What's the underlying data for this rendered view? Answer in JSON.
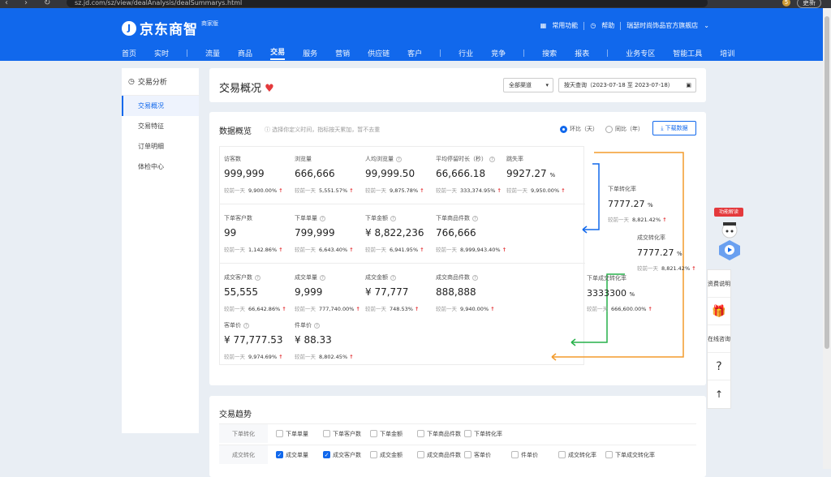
{
  "browser": {
    "url": "sz.jd.com/sz/view/dealAnalysis/dealSummarys.html",
    "profile": "5",
    "update_label": "更新"
  },
  "header": {
    "logo_text": "京东商智",
    "logo_badge": "商家版",
    "links": [
      "常用功能",
      "帮助",
      "瑞瑟时尚饰品官方旗舰店"
    ],
    "nav": [
      "首页",
      "实时",
      "流量",
      "商品",
      "交易",
      "服务",
      "营销",
      "供应链",
      "客户",
      "行业",
      "竞争",
      "搜索",
      "报表",
      "业务专区",
      "智能工具",
      "培训"
    ],
    "active_nav": "交易"
  },
  "sidebar": {
    "title": "交易分析",
    "items": [
      "交易概况",
      "交易特征",
      "订单明细",
      "体检中心"
    ],
    "active": "交易概况"
  },
  "topbar": {
    "title": "交易概况",
    "channel": "全部渠道",
    "date_range": "按天查询（2023-07-18 至 2023-07-18）"
  },
  "overview": {
    "title": "数据概览",
    "hint": "选择你定义时间，指标按天累加，暂不去重",
    "radio": [
      "环比（天）",
      "同比（年）"
    ],
    "download": "下载数据",
    "compare_label": "较前一天",
    "cards": [
      {
        "label": "访客数",
        "value": "999,999",
        "unit": "",
        "change": "9,900.00%"
      },
      {
        "label": "浏览量",
        "value": "666,666",
        "unit": "",
        "change": "5,551.57%"
      },
      {
        "label": "人均浏览量",
        "value": "99,999.50",
        "unit": "",
        "change": "9,875.78%"
      },
      {
        "label": "平均停留时长（秒）",
        "value": "66,666.18",
        "unit": "",
        "change": "333,374.95%"
      },
      {
        "label": "跳失率",
        "value": "9927.27",
        "unit": "%",
        "change": "9,950.00%"
      },
      {
        "label": "下单客户数",
        "value": "99",
        "unit": "",
        "change": "1,142.86%"
      },
      {
        "label": "下单单量",
        "value": "799,999",
        "unit": "",
        "change": "6,643.40%"
      },
      {
        "label": "下单金额",
        "value": "¥ 8,822,236",
        "unit": "",
        "change": "6,941.95%"
      },
      {
        "label": "下单商品件数",
        "value": "766,666",
        "unit": "",
        "change": "8,999,943.40%"
      },
      {
        "label": "成交客户数",
        "value": "55,555",
        "unit": "",
        "change": "66,642.86%"
      },
      {
        "label": "成交单量",
        "value": "9,999",
        "unit": "",
        "change": "777,740.00%"
      },
      {
        "label": "成交金额",
        "value": "¥ 77,777",
        "unit": "",
        "change": "748.53%"
      },
      {
        "label": "成交商品件数",
        "value": "888,888",
        "unit": "",
        "change": "9,940.00%"
      },
      {
        "label": "客单价",
        "value": "¥ 77,777.53",
        "unit": "",
        "change": "9,974.69%"
      },
      {
        "label": "件单价",
        "value": "¥ 88.33",
        "unit": "",
        "change": "8,802.45%"
      }
    ],
    "rates": [
      {
        "label": "下单转化率",
        "value": "7777.27",
        "unit": "%",
        "change": "8,821.42%"
      },
      {
        "label": "成交转化率",
        "value": "7777.27",
        "unit": "%",
        "change": "8,821.42%"
      },
      {
        "label": "下单成交转化率",
        "value": "3333300",
        "unit": "%",
        "change": "666,600.00%"
      }
    ]
  },
  "trend": {
    "title": "交易趋势",
    "rows": [
      {
        "label": "下单转化",
        "items": [
          {
            "t": "下单单量",
            "on": false
          },
          {
            "t": "下单客户数",
            "on": false
          },
          {
            "t": "下单金额",
            "on": false
          },
          {
            "t": "下单商品件数",
            "on": false
          },
          {
            "t": "下单转化率",
            "on": false
          }
        ]
      },
      {
        "label": "成交转化",
        "items": [
          {
            "t": "成交单量",
            "on": true
          },
          {
            "t": "成交客户数",
            "on": true
          },
          {
            "t": "成交金额",
            "on": false
          },
          {
            "t": "成交商品件数",
            "on": false
          },
          {
            "t": "客单价",
            "on": false
          },
          {
            "t": "件单价",
            "on": false
          },
          {
            "t": "成交转化率",
            "on": false
          },
          {
            "t": "下单成交转化率",
            "on": false
          }
        ]
      }
    ]
  },
  "float": {
    "tag": "功能解读",
    "items": [
      "资费说明",
      "",
      "在线咨询",
      "?",
      "↑"
    ]
  },
  "colors": {
    "brand": "#1168ec",
    "up": "#e4393c",
    "arrow_blue": "#1168ec",
    "arrow_green": "#27b14a",
    "arrow_orange": "#f39b2c"
  }
}
